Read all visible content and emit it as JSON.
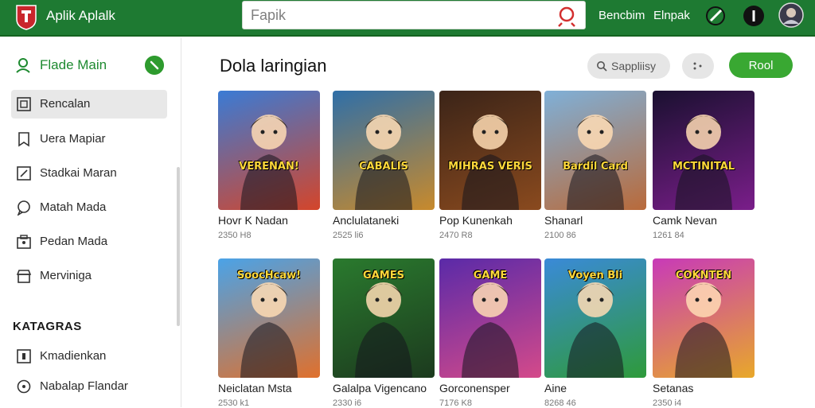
{
  "header": {
    "app_title": "Aplik Aplalk",
    "search_value": "Fapik",
    "links": [
      "Bencbim",
      "Elnpak"
    ],
    "brand_color": "#1e7a32"
  },
  "sidebar": {
    "main_item": "Flade Main",
    "items": [
      {
        "label": "Rencalan",
        "icon": "square-icon",
        "active": true
      },
      {
        "label": "Uera Mapiar",
        "icon": "bookmark-icon",
        "active": false
      },
      {
        "label": "Stadkai Maran",
        "icon": "edit-icon",
        "active": false
      },
      {
        "label": "Matah Mada",
        "icon": "chat-icon",
        "active": false
      },
      {
        "label": "Pedan Mada",
        "icon": "folder-icon",
        "active": false
      },
      {
        "label": "Merviniga",
        "icon": "storefront-icon",
        "active": false
      }
    ],
    "section_title": "KATAGRAS",
    "section_items": [
      {
        "label": "Kmadienkan",
        "icon": "square-icon"
      },
      {
        "label": "Nabalap Flandar",
        "icon": "circle-icon"
      }
    ]
  },
  "main": {
    "title": "Dola laringian",
    "search_pill": "Sappliisy",
    "run_button": "Rool",
    "games_row1": [
      {
        "name": "Hovr K Nadan",
        "meta": "2350 H8",
        "art_text": "VERENAN!",
        "bg": [
          "#3a7bd5",
          "#d4452a"
        ]
      },
      {
        "name": "Anclulataneki",
        "meta": "2525 li6",
        "art_text": "CABALIS",
        "bg": [
          "#2f6fa8",
          "#c88a2c"
        ]
      },
      {
        "name": "Pop Kunenkah",
        "meta": "2470 R8",
        "art_text": "MIHRAS VERIS",
        "bg": [
          "#3b2418",
          "#8a4a1e"
        ]
      },
      {
        "name": "Shanarl",
        "meta": "2100 86",
        "art_text": "Bardil Card",
        "bg": [
          "#7fb0d8",
          "#b96a3a"
        ]
      },
      {
        "name": "Camk Nevan",
        "meta": "1261 84",
        "art_text": "MCTINITAL",
        "bg": [
          "#1a1030",
          "#7a1e8a"
        ]
      }
    ],
    "games_row2": [
      {
        "name": "Neiclatan Msta",
        "meta": "2530 k1",
        "art_text": "SoocHcaw!",
        "bg": [
          "#4aa3e8",
          "#e0702c"
        ]
      },
      {
        "name": "Galalpa Vigencano",
        "meta": "2330 i6",
        "art_text": "GAMES",
        "bg": [
          "#2a7a2e",
          "#1c3a1e"
        ]
      },
      {
        "name": "Gorconensper",
        "meta": "7176 K8",
        "art_text": "GAME",
        "bg": [
          "#5a2aa8",
          "#d44a8a"
        ]
      },
      {
        "name": "Aine",
        "meta": "8268 46",
        "art_text": "Voyen Bli",
        "bg": [
          "#3a8ad8",
          "#2e9a3a"
        ]
      },
      {
        "name": "Setanas",
        "meta": "2350 i4",
        "art_text": "COKNTEN",
        "bg": [
          "#c83ab8",
          "#e8a82a"
        ]
      }
    ]
  }
}
